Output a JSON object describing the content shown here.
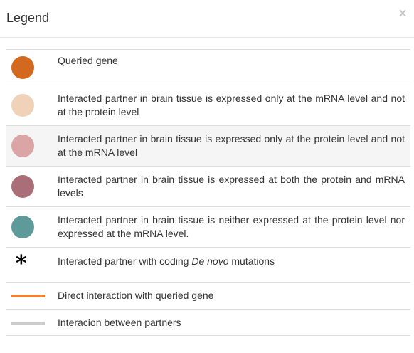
{
  "header": {
    "title": "Legend",
    "close_label": "×"
  },
  "legend": {
    "items": [
      {
        "symbol": "circle",
        "color": "#d2691e",
        "text": "Queried gene"
      },
      {
        "symbol": "circle",
        "color": "#f0d2b9",
        "text": "Interacted partner in brain tissue is expressed only at the mRNA level and not at the protein level"
      },
      {
        "symbol": "circle",
        "color": "#dca5a5",
        "text": "Interacted partner in brain tissue is expressed only at the protein level and not at the mRNA level"
      },
      {
        "symbol": "circle",
        "color": "#aa6e78",
        "text": "Interacted partner in brain tissue is expressed at both the protein and mRNA levels"
      },
      {
        "symbol": "circle",
        "color": "#5f9a9b",
        "text": "Interacted partner in brain tissue is neither expressed at the protein level nor expressed at the mRNA level."
      },
      {
        "symbol": "asterisk",
        "glyph": "*",
        "text_before": "Interacted partner with coding ",
        "text_italic": "De novo",
        "text_after": " mutations"
      },
      {
        "symbol": "line",
        "color": "#e8833a",
        "text": "Direct interaction with queried gene"
      },
      {
        "symbol": "line",
        "color": "#cccccc",
        "text": "Interacion between partners"
      }
    ]
  }
}
